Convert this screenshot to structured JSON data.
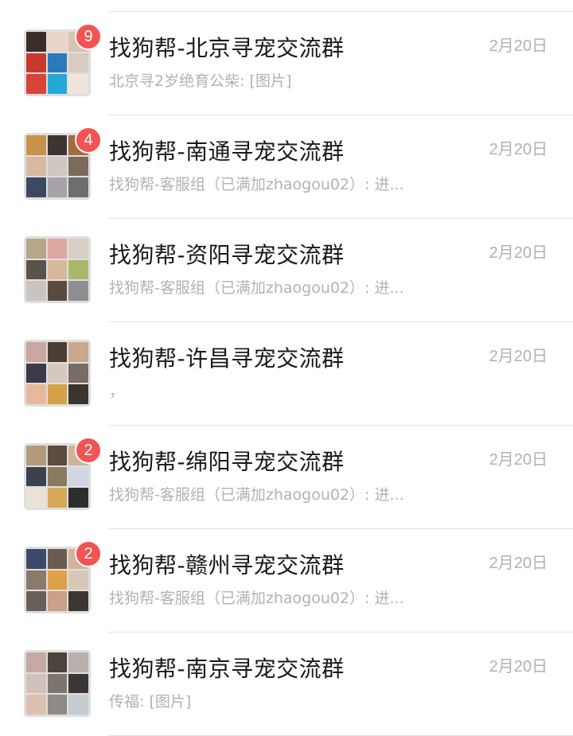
{
  "chats": [
    {
      "title": "找狗帮-北京寻宠交流群",
      "preview": "北京寻2岁绝育公柴: [图片]",
      "date": "2月20日",
      "unread": "9",
      "thumbs": [
        "#3a2e26",
        "#e9d6c8",
        "#d9c4b4",
        "#c83a2e",
        "#2a7bbd",
        "#d7cbc2",
        "#d8443a",
        "#24a8d8",
        "#efe4dc"
      ]
    },
    {
      "title": "找狗帮-南通寻宠交流群",
      "preview": "找狗帮-客服组（已满加zhaogou02）: 进...",
      "date": "2月20日",
      "unread": "4",
      "thumbs": [
        "#c8924a",
        "#3c3430",
        "#a36b3e",
        "#d9b8a2",
        "#cfc7c0",
        "#7c6a5a",
        "#3b4a5e",
        "#a9a2a8",
        "#6e6e70"
      ]
    },
    {
      "title": "找狗帮-资阳寻宠交流群",
      "preview": "找狗帮-客服组（已满加zhaogou02）: 进...",
      "date": "2月20日",
      "unread": "",
      "thumbs": [
        "#b8a68a",
        "#e0a6a0",
        "#d8cfc4",
        "#5b5248",
        "#d6b89a",
        "#a9b86a",
        "#c9c4be",
        "#5a4b3e",
        "#8c8e92"
      ]
    },
    {
      "title": "找狗帮-许昌寻宠交流群",
      "preview": "，",
      "date": "2月20日",
      "unread": "",
      "thumbs": [
        "#c9a6a0",
        "#4a3e34",
        "#caa890",
        "#3a3a48",
        "#d8c8bc",
        "#7a6c64",
        "#e8b89c",
        "#d6a048",
        "#3c342e"
      ]
    },
    {
      "title": "找狗帮-绵阳寻宠交流群",
      "preview": "找狗帮-客服组（已满加zhaogou02）: 进...",
      "date": "2月20日",
      "unread": "2",
      "thumbs": [
        "#b49a7a",
        "#5c4c3e",
        "#d0b49a",
        "#3a4250",
        "#8a7a5e",
        "#cfd8e2",
        "#eae2d8",
        "#d8a858",
        "#2e2e2e"
      ]
    },
    {
      "title": "找狗帮-赣州寻宠交流群",
      "preview": "找狗帮-客服组（已满加zhaogou02）: 进...",
      "date": "2月20日",
      "unread": "2",
      "thumbs": [
        "#3c4a6a",
        "#6c5c50",
        "#d2b49c",
        "#8a7a6a",
        "#e0a048",
        "#d8c8b8",
        "#6a5e58",
        "#caa088",
        "#3e3632"
      ]
    },
    {
      "title": "找狗帮-南京寻宠交流群",
      "preview": "传福: [图片]",
      "date": "2月20日",
      "unread": "",
      "thumbs": [
        "#c6a8a2",
        "#4c443c",
        "#b8b0aa",
        "#cfc2b8",
        "#7c746e",
        "#3a3634",
        "#dcc0b0",
        "#8e8a86",
        "#c4ccd4"
      ]
    }
  ]
}
